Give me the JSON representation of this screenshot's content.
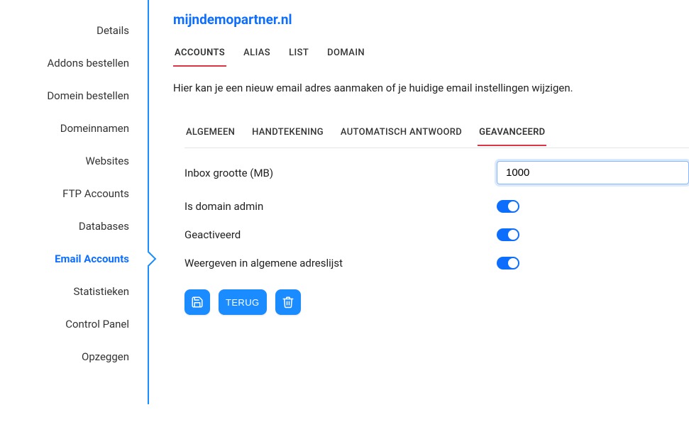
{
  "sidebar": {
    "items": [
      {
        "label": "Details"
      },
      {
        "label": "Addons bestellen"
      },
      {
        "label": "Domein bestellen"
      },
      {
        "label": "Domeinnamen"
      },
      {
        "label": "Websites"
      },
      {
        "label": "FTP Accounts"
      },
      {
        "label": "Databases"
      },
      {
        "label": "Email Accounts"
      },
      {
        "label": "Statistieken"
      },
      {
        "label": "Control Panel"
      },
      {
        "label": "Opzeggen"
      }
    ],
    "active_index": 7
  },
  "page": {
    "title": "mijndemopartner.nl",
    "description": "Hier kan je een nieuw email adres aanmaken of je huidige email instellingen wijzigen."
  },
  "tabs": {
    "items": [
      {
        "label": "ACCOUNTS"
      },
      {
        "label": "ALIAS"
      },
      {
        "label": "LIST"
      },
      {
        "label": "DOMAIN"
      }
    ],
    "active_index": 0
  },
  "subtabs": {
    "items": [
      {
        "label": "ALGEMEEN"
      },
      {
        "label": "HANDTEKENING"
      },
      {
        "label": "AUTOMATISCH ANTWOORD"
      },
      {
        "label": "GEAVANCEERD"
      }
    ],
    "active_index": 3
  },
  "form": {
    "inbox_size_label": "Inbox grootte (MB)",
    "inbox_size_value": "1000",
    "is_domain_admin_label": "Is domain admin",
    "is_domain_admin_value": true,
    "activated_label": "Geactiveerd",
    "activated_value": true,
    "show_in_gal_label": "Weergeven in algemene adreslijst",
    "show_in_gal_value": true
  },
  "actions": {
    "back_label": "TERUG"
  }
}
